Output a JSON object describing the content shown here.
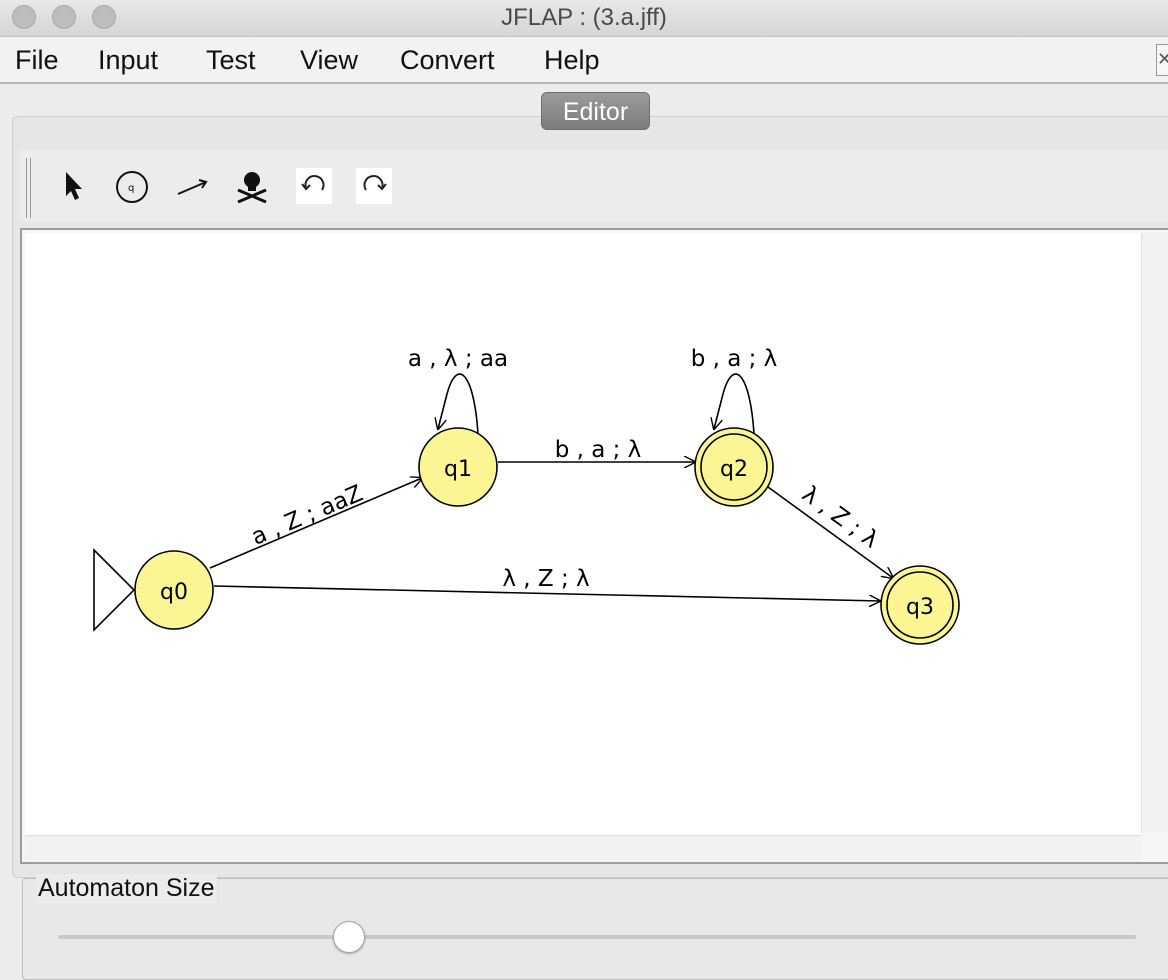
{
  "window": {
    "title": "JFLAP : (3.a.jff)"
  },
  "menu": [
    "File",
    "Input",
    "Test",
    "View",
    "Convert",
    "Help"
  ],
  "tabs": {
    "editor": "Editor"
  },
  "tools": [
    "attribute-editor",
    "state-creator",
    "transition-creator",
    "deleter",
    "undo",
    "redo"
  ],
  "automaton": {
    "states": [
      {
        "id": "q0",
        "initial": true,
        "final": false
      },
      {
        "id": "q1",
        "initial": false,
        "final": false
      },
      {
        "id": "q2",
        "initial": false,
        "final": true
      },
      {
        "id": "q3",
        "initial": false,
        "final": true
      }
    ],
    "transitions": [
      {
        "from": "q0",
        "to": "q1",
        "label": "a , Z ; aaZ"
      },
      {
        "from": "q1",
        "to": "q1",
        "label": "a , λ ; aa"
      },
      {
        "from": "q1",
        "to": "q2",
        "label": "b , a ; λ"
      },
      {
        "from": "q2",
        "to": "q2",
        "label": "b , a ; λ"
      },
      {
        "from": "q2",
        "to": "q3",
        "label": "λ , Z ; λ"
      },
      {
        "from": "q0",
        "to": "q3",
        "label": "λ , Z ; λ"
      }
    ]
  },
  "size": {
    "label": "Automaton Size",
    "value": 0.27
  },
  "colors": {
    "state_fill": "#fbf594",
    "tab_bg": "#8a8a8a"
  }
}
